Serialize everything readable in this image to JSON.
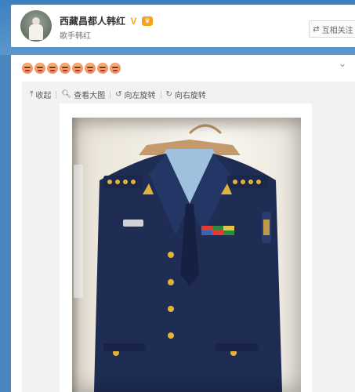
{
  "profile": {
    "name": "西藏昌都人韩红",
    "subtitle": "歌手韩红",
    "verified_icon": "v-icon",
    "member_icon": "crown-icon",
    "follow_button": "互相关注",
    "follow_icon": "swap-icon"
  },
  "post": {
    "emoji_count": 8,
    "emoji_icon": "emoji-icon",
    "collapse_icon": "chevron-down-icon"
  },
  "toolbar": {
    "collapse": "收起",
    "view_large": "查看大图",
    "rotate_left": "向左旋转",
    "rotate_right": "向右旋转"
  },
  "colors": {
    "background": "#4a86bd",
    "uniform": "#1f2d55",
    "gold": "#e2b33c"
  }
}
